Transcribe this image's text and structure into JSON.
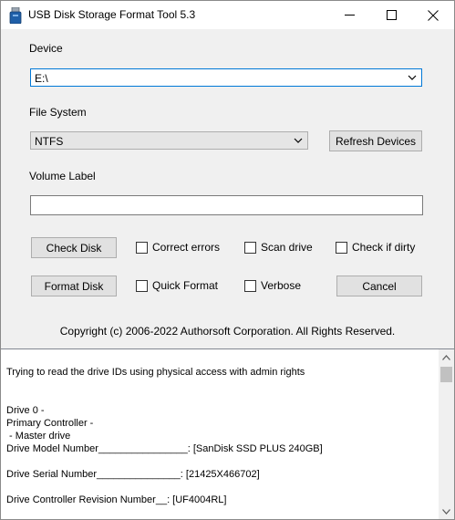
{
  "window": {
    "title": "USB Disk Storage Format Tool 5.3",
    "controls": {
      "minimize": "minimize-icon",
      "maximize": "maximize-icon",
      "close": "close-icon"
    }
  },
  "form": {
    "device_label": "Device",
    "device_value": "E:\\",
    "filesystem_label": "File System",
    "filesystem_value": "NTFS",
    "refresh_button": "Refresh Devices",
    "volume_label": "Volume Label",
    "volume_value": ""
  },
  "actions": {
    "check_disk": "Check Disk",
    "correct_errors": "Correct errors",
    "scan_drive": "Scan drive",
    "check_if_dirty": "Check if dirty",
    "format_disk": "Format Disk",
    "quick_format": "Quick Format",
    "verbose": "Verbose",
    "cancel": "Cancel"
  },
  "checkboxes": {
    "correct_errors": false,
    "scan_drive": false,
    "check_if_dirty": false,
    "quick_format": false,
    "verbose": false
  },
  "copyright": "Copyright (c) 2006-2022 Authorsoft Corporation. All Rights Reserved.",
  "log": {
    "lines": [
      "Trying to read the drive IDs using physical access with admin rights",
      "",
      "",
      "Drive 0 -",
      "Primary Controller -",
      " - Master drive",
      "Drive Model Number________________: [SanDisk SSD PLUS 240GB]",
      "",
      "Drive Serial Number_______________: [21425X466702]",
      "",
      "Drive Controller Revision Number__: [UF4004RL]"
    ]
  },
  "colors": {
    "focus_border": "#0078d7",
    "window_bg": "#f0f0f0",
    "titlebar_bg": "#ffffff"
  }
}
